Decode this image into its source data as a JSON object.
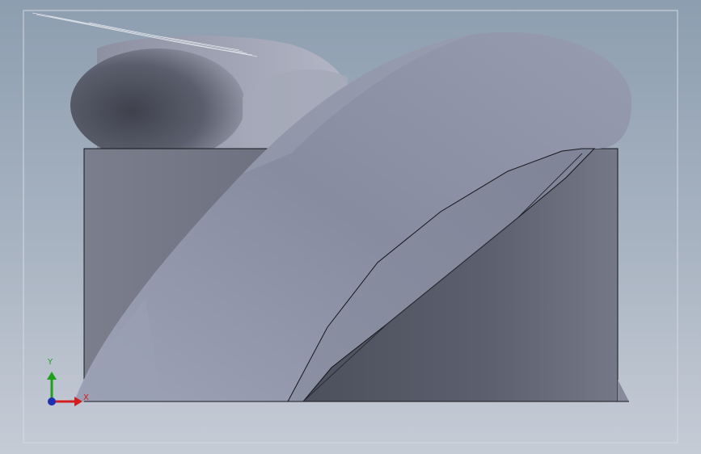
{
  "viewport": {
    "background_top": "#8d9eb0",
    "background_bottom": "#c6ccd6",
    "frame_color": "#d4d9e0"
  },
  "model": {
    "box_face_color": "#6e7180",
    "cylinder_color": "#8f93a4",
    "blade_color": "#8e93a6",
    "edge_color": "#15161c"
  },
  "triad": {
    "x_label": "X",
    "y_label": "Y",
    "x_color": "#d21e1e",
    "y_color": "#1ea01e",
    "z_color": "#1e2fb4"
  }
}
